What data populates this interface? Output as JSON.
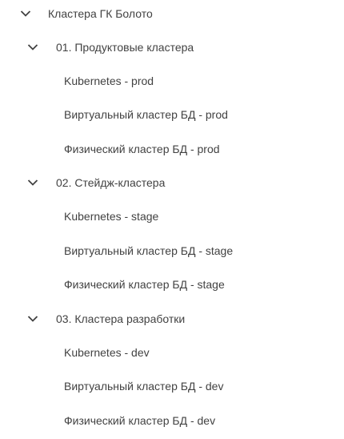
{
  "tree": {
    "root": {
      "label": "Кластера ГК Болото",
      "expanded": true,
      "icon": "chevron-down-icon"
    },
    "groups": [
      {
        "label": "01. Продуктовые кластера",
        "expanded": true,
        "items": [
          "Kubernetes - prod",
          "Виртуальный кластер БД - prod",
          "Физический кластер БД - prod"
        ]
      },
      {
        "label": "02. Стейдж-кластера",
        "expanded": true,
        "items": [
          "Kubernetes - stage",
          "Виртуальный кластер БД - stage",
          "Физический кластер БД - stage"
        ]
      },
      {
        "label": "03. Кластера разработки",
        "expanded": true,
        "items": [
          "Kubernetes - dev",
          "Виртуальный кластер БД - dev",
          "Физический кластер БД - dev"
        ]
      }
    ]
  },
  "colors": {
    "text": "#424242",
    "chevron": "#424242",
    "background": "#ffffff"
  }
}
